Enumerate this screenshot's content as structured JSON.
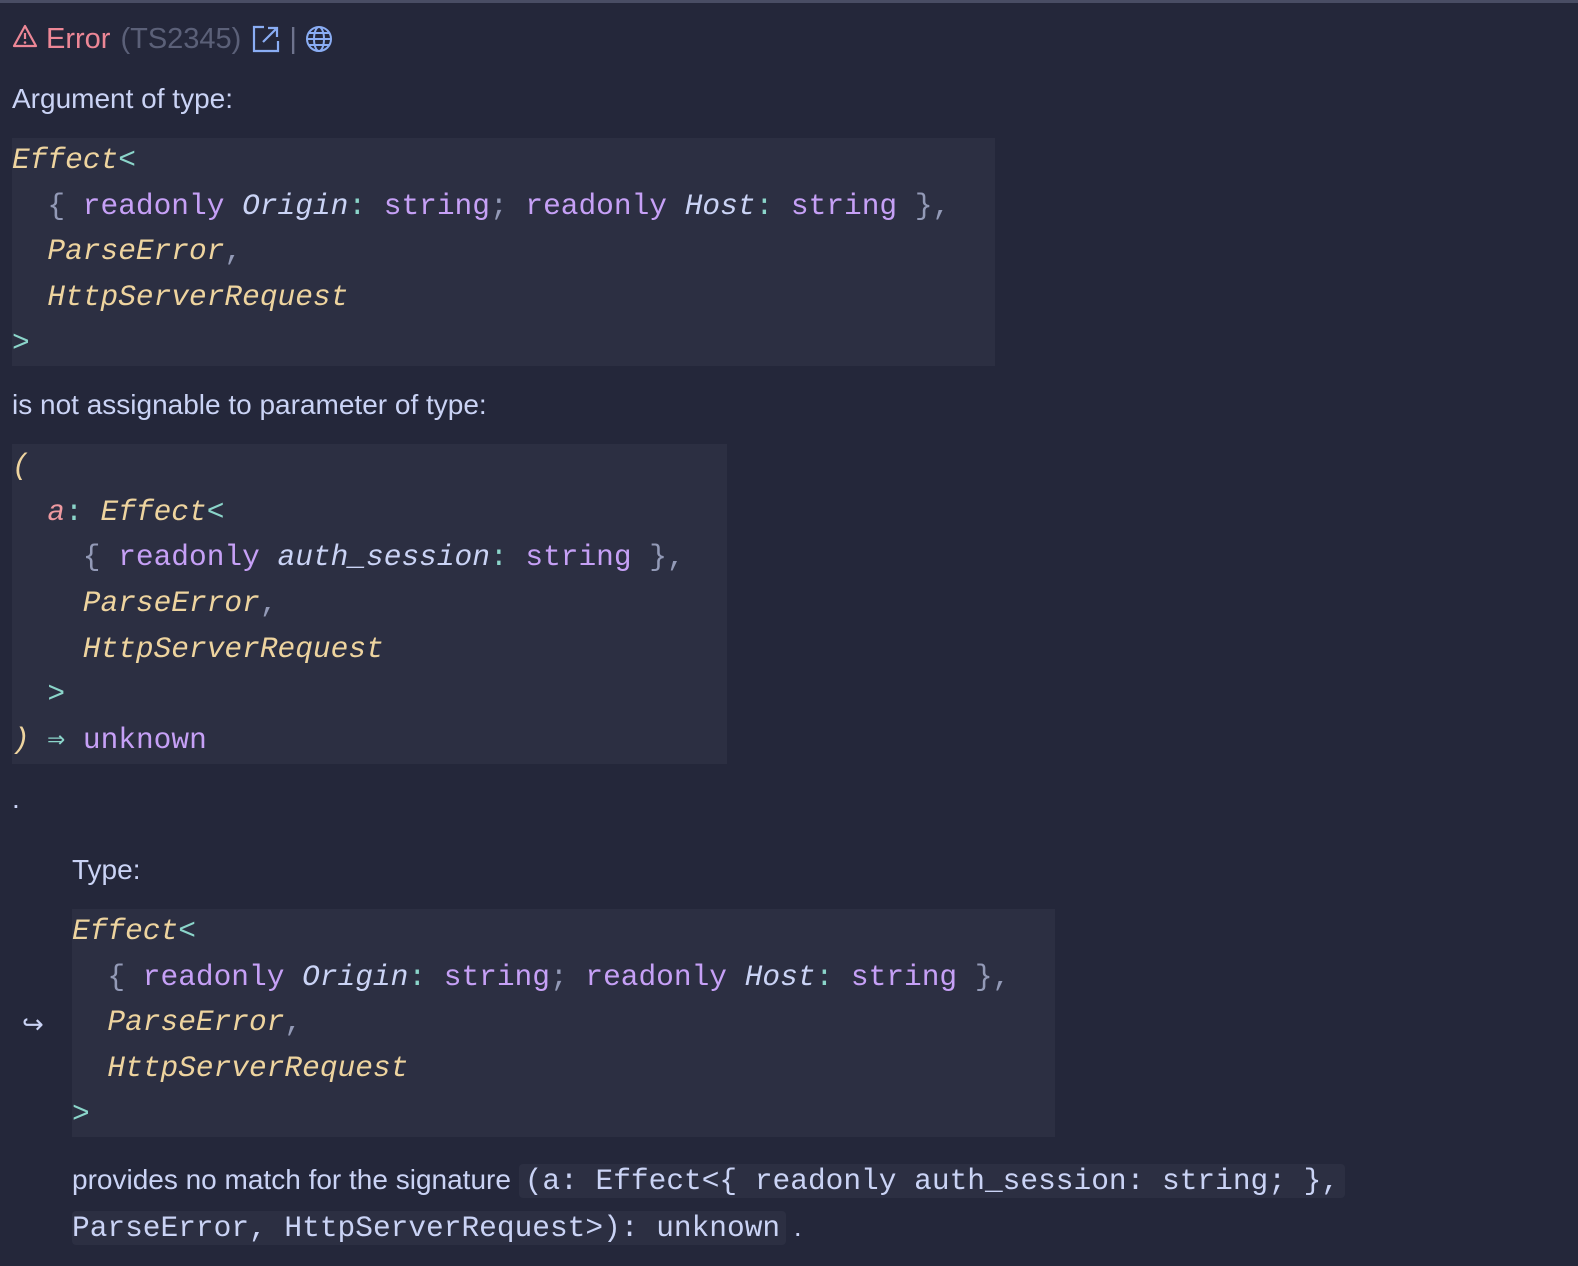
{
  "header": {
    "icon": "warning-icon",
    "title": "Error",
    "code": "(TS2345)",
    "separator": "|",
    "link_icon": "external-link-icon",
    "web_icon": "globe-icon"
  },
  "texts": {
    "argument": "Argument of type:",
    "not_assignable": "is not assignable to parameter of type:",
    "period": ".",
    "type_label": "Type:",
    "arrow": "↪",
    "provides": "provides no match for the signature",
    "sig_part1": "(a: Effect<{ readonly auth_session: string; },",
    "sig_part2": "ParseError, HttpServerRequest>): unknown",
    "end_period": "."
  },
  "blocks": [
    {
      "lines": [
        {
          "indent": 0,
          "tokens": [
            {
              "c": "t",
              "v": "Effect"
            },
            {
              "c": "p",
              "v": "<"
            }
          ]
        },
        {
          "indent": 2,
          "tokens": [
            {
              "c": "b",
              "v": "{ "
            },
            {
              "c": "k",
              "v": "readonly "
            },
            {
              "c": "prop",
              "v": "Origin"
            },
            {
              "c": "p",
              "v": ": "
            },
            {
              "c": "k",
              "v": "string"
            },
            {
              "c": "b",
              "v": "; "
            },
            {
              "c": "k",
              "v": "readonly "
            },
            {
              "c": "prop",
              "v": "Host"
            },
            {
              "c": "p",
              "v": ": "
            },
            {
              "c": "k",
              "v": "string"
            },
            {
              "c": "b",
              "v": " },"
            }
          ]
        },
        {
          "indent": 2,
          "tokens": [
            {
              "c": "t",
              "v": "ParseError"
            },
            {
              "c": "b",
              "v": ","
            }
          ]
        },
        {
          "indent": 2,
          "tokens": [
            {
              "c": "t",
              "v": "HttpServerRequest"
            }
          ]
        },
        {
          "indent": 0,
          "tokens": [
            {
              "c": "p",
              "v": ">"
            }
          ]
        }
      ]
    },
    {
      "lines": [
        {
          "indent": 0,
          "tokens": [
            {
              "c": "t",
              "v": "("
            }
          ]
        },
        {
          "indent": 2,
          "tokens": [
            {
              "c": "param",
              "v": "a"
            },
            {
              "c": "p",
              "v": ": "
            },
            {
              "c": "t",
              "v": "Effect"
            },
            {
              "c": "p",
              "v": "<"
            }
          ]
        },
        {
          "indent": 4,
          "tokens": [
            {
              "c": "b",
              "v": "{ "
            },
            {
              "c": "k",
              "v": "readonly "
            },
            {
              "c": "prop",
              "v": "auth_session"
            },
            {
              "c": "p",
              "v": ": "
            },
            {
              "c": "k",
              "v": "string"
            },
            {
              "c": "b",
              "v": " },"
            }
          ]
        },
        {
          "indent": 4,
          "tokens": [
            {
              "c": "t",
              "v": "ParseError"
            },
            {
              "c": "b",
              "v": ","
            }
          ]
        },
        {
          "indent": 4,
          "tokens": [
            {
              "c": "t",
              "v": "HttpServerRequest"
            }
          ]
        },
        {
          "indent": 2,
          "tokens": [
            {
              "c": "p",
              "v": ">"
            }
          ]
        },
        {
          "indent": 0,
          "tokens": [
            {
              "c": "t",
              "v": ")"
            },
            {
              "c": "p",
              "v": " ⇒ "
            },
            {
              "c": "k",
              "v": "unknown"
            }
          ]
        }
      ]
    },
    {
      "lines": [
        {
          "indent": 0,
          "tokens": [
            {
              "c": "t",
              "v": "Effect"
            },
            {
              "c": "p",
              "v": "<"
            }
          ]
        },
        {
          "indent": 2,
          "tokens": [
            {
              "c": "b",
              "v": "{ "
            },
            {
              "c": "k",
              "v": "readonly "
            },
            {
              "c": "prop",
              "v": "Origin"
            },
            {
              "c": "p",
              "v": ": "
            },
            {
              "c": "k",
              "v": "string"
            },
            {
              "c": "b",
              "v": "; "
            },
            {
              "c": "k",
              "v": "readonly "
            },
            {
              "c": "prop",
              "v": "Host"
            },
            {
              "c": "p",
              "v": ": "
            },
            {
              "c": "k",
              "v": "string"
            },
            {
              "c": "b",
              "v": " },"
            }
          ]
        },
        {
          "indent": 2,
          "tokens": [
            {
              "c": "t",
              "v": "ParseError"
            },
            {
              "c": "b",
              "v": ","
            }
          ]
        },
        {
          "indent": 2,
          "tokens": [
            {
              "c": "t",
              "v": "HttpServerRequest"
            }
          ]
        },
        {
          "indent": 0,
          "tokens": [
            {
              "c": "p",
              "v": ">"
            }
          ]
        }
      ]
    }
  ],
  "colors": {
    "error": "#ed8796",
    "link": "#8aadf4",
    "background": "#24273a",
    "code_bg": "#2c2f42"
  }
}
